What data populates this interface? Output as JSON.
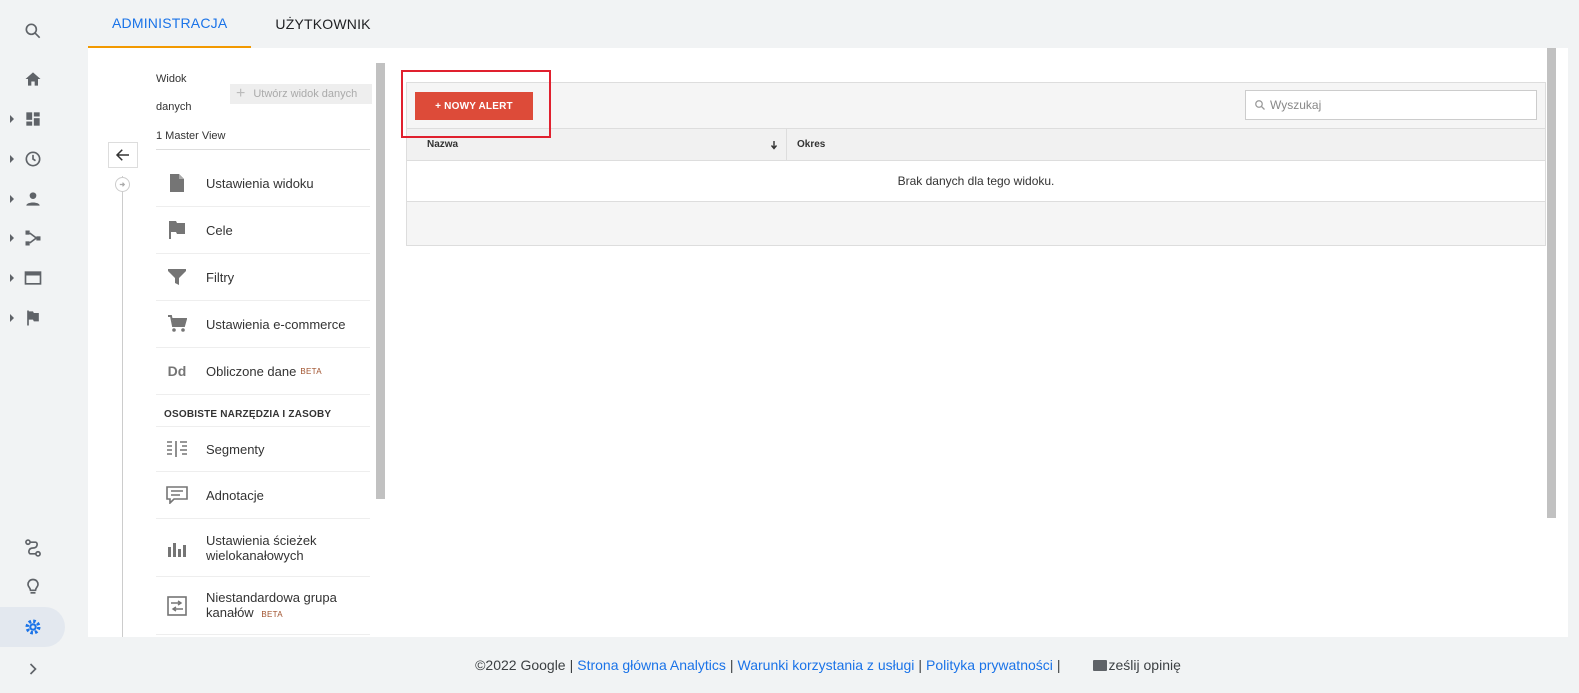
{
  "tabs": [
    {
      "label": "ADMINISTRACJA",
      "active": true
    },
    {
      "label": "UŻYTKOWNIK",
      "active": false
    }
  ],
  "rail": {
    "icons": [
      "search-icon",
      "home-icon",
      "dashboard-icon",
      "clock-icon",
      "person-icon",
      "acquisition-icon",
      "behavior-icon",
      "flag-icon",
      "path-icon",
      "lightbulb-icon",
      "gear-icon",
      "chevron-right-icon"
    ]
  },
  "view": {
    "label_line1": "Widok",
    "label_line2": "danych",
    "create_button": "Utwórz widok danych",
    "selected": "1 Master View"
  },
  "menu": {
    "items": [
      {
        "label": "Ustawienia widoku",
        "icon": "document-icon"
      },
      {
        "label": "Cele",
        "icon": "flag-icon"
      },
      {
        "label": "Filtry",
        "icon": "filter-icon"
      },
      {
        "label": "Ustawienia e-commerce",
        "icon": "cart-icon"
      },
      {
        "label": "Obliczone dane",
        "icon": "dd-icon",
        "badge": "BETA"
      }
    ],
    "section_title": "OSOBISTE NARZĘDZIA I ZASOBY",
    "section_items": [
      {
        "label": "Segmenty",
        "icon": "segments-icon"
      },
      {
        "label": "Adnotacje",
        "icon": "annotation-icon"
      },
      {
        "label": "Ustawienia ścieżek wielokanałowych",
        "icon": "bar-chart-icon"
      },
      {
        "label": "Niestandardowa grupa kanałów",
        "icon": "channel-group-icon",
        "badge": "BETA"
      }
    ],
    "dd_glyph": "Dd"
  },
  "alerts": {
    "new_button": "+ NOWY ALERT",
    "search_placeholder": "Wyszukaj",
    "columns": [
      "Nazwa",
      "Okres"
    ],
    "empty_message": "Brak danych dla tego widoku."
  },
  "footer": {
    "copyright": "©2022 Google",
    "links": [
      "Strona główna Analytics",
      "Warunki korzystania z usługi",
      "Polityka prywatności"
    ],
    "separator": "|",
    "feedback": "ześlij opinię"
  },
  "colors": {
    "accent": "#1a73e8",
    "tab_underline": "#f29900",
    "alert_button": "#dd4b39",
    "highlight_box": "#e0202e"
  }
}
